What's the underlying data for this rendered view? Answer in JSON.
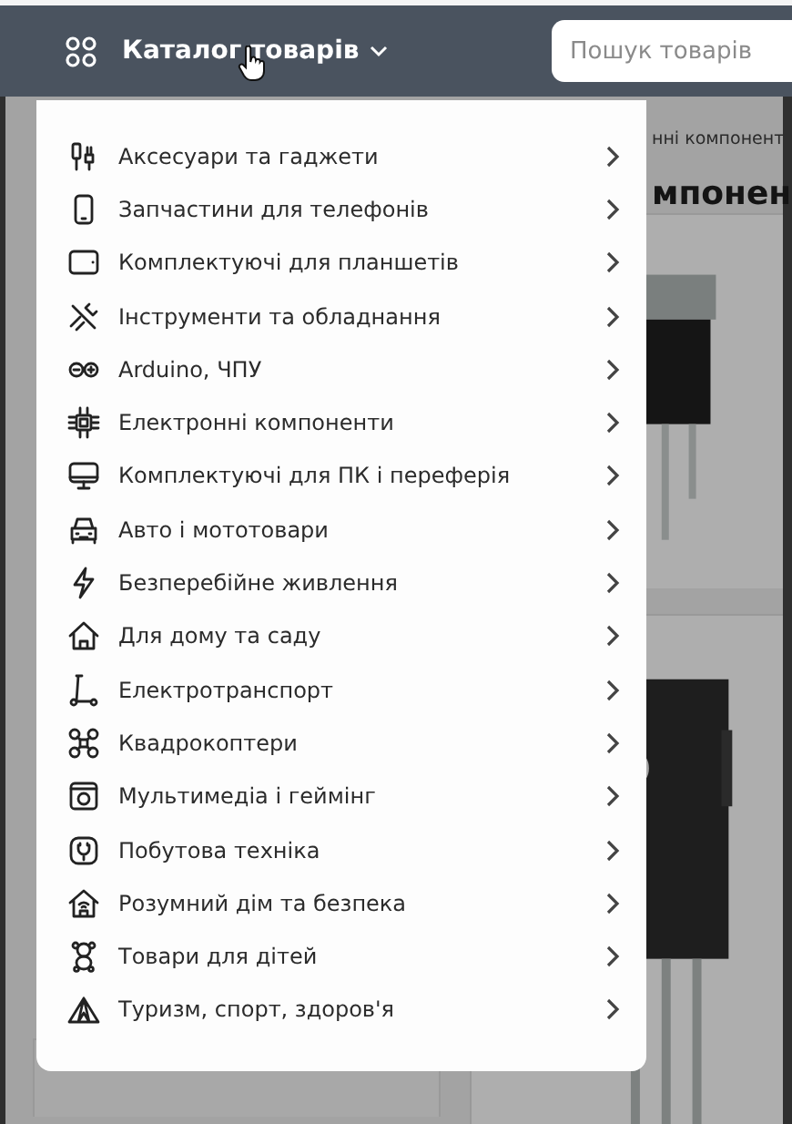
{
  "header": {
    "catalog_button": "Каталог товарів",
    "search": {
      "placeholder": "Пошук товарів"
    }
  },
  "background_page": {
    "breadcrumb": "нні компонент",
    "heading": "мпонен"
  },
  "menu": {
    "items": [
      {
        "label": "Аксесуари та гаджети"
      },
      {
        "label": "Запчастини для телефонів"
      },
      {
        "label": "Комплектуючі для планшетів"
      },
      {
        "label": "Інструменти та обладнання"
      },
      {
        "label": "Arduino, ЧПУ"
      },
      {
        "label": "Електронні компоненти"
      },
      {
        "label": "Комплектуючі для ПК і переферія"
      },
      {
        "label": "Авто і мототовари"
      },
      {
        "label": "Безперебійне живлення"
      },
      {
        "label": "Для дому та саду"
      },
      {
        "label": "Електротранспорт"
      },
      {
        "label": "Квадрокоптери"
      },
      {
        "label": "Мультимедіа і геймінг"
      },
      {
        "label": "Побутова техніка"
      },
      {
        "label": "Розумний дім та безпека"
      },
      {
        "label": "Товари для дітей"
      },
      {
        "label": "Туризм, спорт, здоров'я"
      }
    ]
  }
}
